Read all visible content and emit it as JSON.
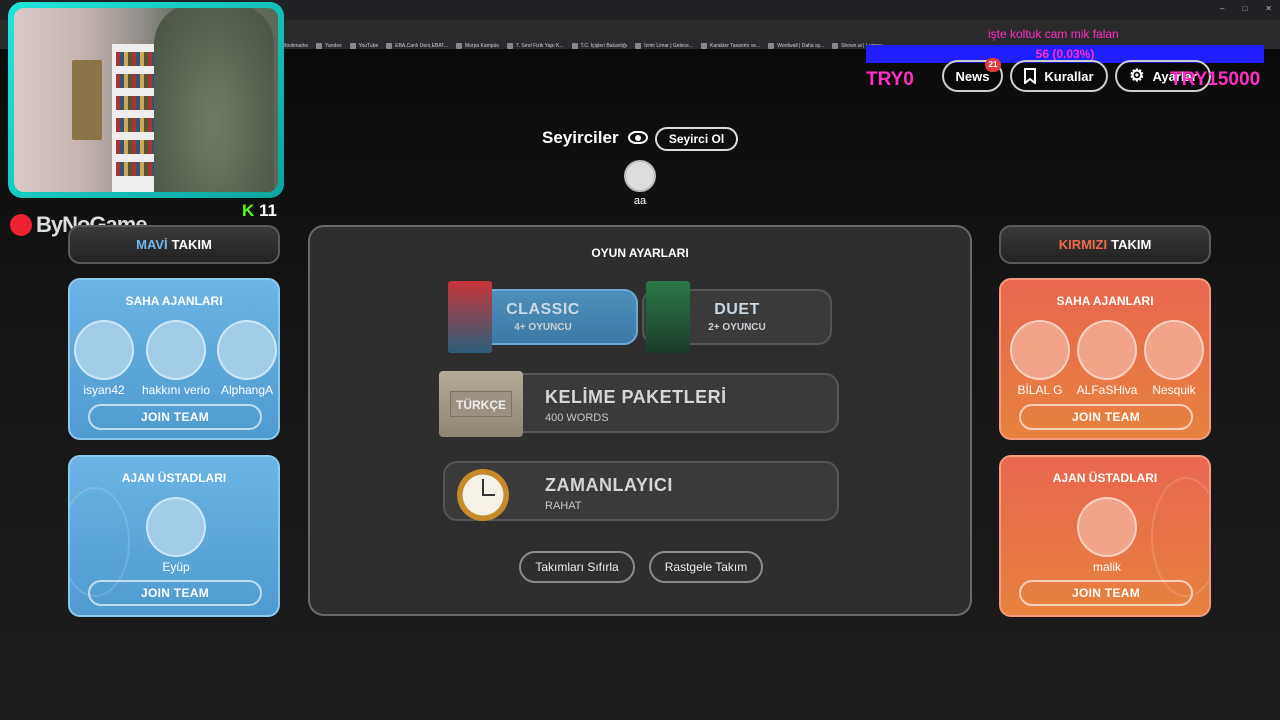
{
  "browser": {
    "bookmarks": [
      "Bookmarks",
      "Yandex",
      "YouTube",
      "EBA,Canlı Ders,EBAT...",
      "Morpa Kampüs",
      "7. Sınıf Fizik Yapı K...",
      "T.C. İçişleri Bakanlığı",
      "İzmir Limar | Gelece...",
      "Karakter Tasarımı ve...",
      "Wordwall | Daha ay...",
      "Shown.ai | Lumora"
    ]
  },
  "overlay": {
    "chat_line": "işte koltuk cam mik falan",
    "progress_label": "56 (0.03%)",
    "try_left": "TRY0",
    "try_right": "TRY15000",
    "kick_count": "11",
    "logo_text": "ByNoGame"
  },
  "nav": {
    "news_label": "News",
    "news_badge": "21",
    "rules_label": "Kurallar",
    "settings_label": "Ayarlar"
  },
  "spectators": {
    "title": "Seyirciler",
    "join_label": "Seyirci Ol",
    "member": "aa"
  },
  "blue_team": {
    "header_colored": "MAVİ",
    "header_rest": "TAKIM",
    "operatives": {
      "title": "SAHA AJANLARI",
      "players": [
        "isyan42",
        "hakkını verio",
        "AlphangA"
      ],
      "join_label": "JOIN TEAM"
    },
    "spymasters": {
      "title": "AJAN ÜSTADLARI",
      "players": [
        "Eyüp"
      ],
      "join_label": "JOIN TEAM"
    }
  },
  "red_team": {
    "header_colored": "KIRMIZI",
    "header_rest": "TAKIM",
    "operatives": {
      "title": "SAHA AJANLARI",
      "players": [
        "BİLAL G",
        "ALFaSHiva",
        "Nesquik"
      ],
      "join_label": "JOIN TEAM"
    },
    "spymasters": {
      "title": "AJAN ÜSTADLARI",
      "players": [
        "malik"
      ],
      "join_label": "JOIN TEAM"
    }
  },
  "settings": {
    "title": "OYUN AYARLARI",
    "modes": [
      {
        "title": "CLASSIC",
        "subtitle": "4+ OYUNCU",
        "selected": true
      },
      {
        "title": "DUET",
        "subtitle": "2+ OYUNCU",
        "selected": false
      }
    ],
    "word_pack": {
      "title": "KELİME PAKETLERİ",
      "subtitle": "400 WORDS",
      "pack_label": "TÜRKÇE"
    },
    "timer": {
      "title": "ZAMANLAYICI",
      "subtitle": "RAHAT"
    },
    "reset_label": "Takımları Sıfırla",
    "random_label": "Rastgele Takım"
  },
  "colors": {
    "blue_accent": "#6fb6ee",
    "red_accent": "#ef6a4a",
    "overlay_magenta": "#ff2ec4",
    "kick_green": "#53fc18"
  }
}
